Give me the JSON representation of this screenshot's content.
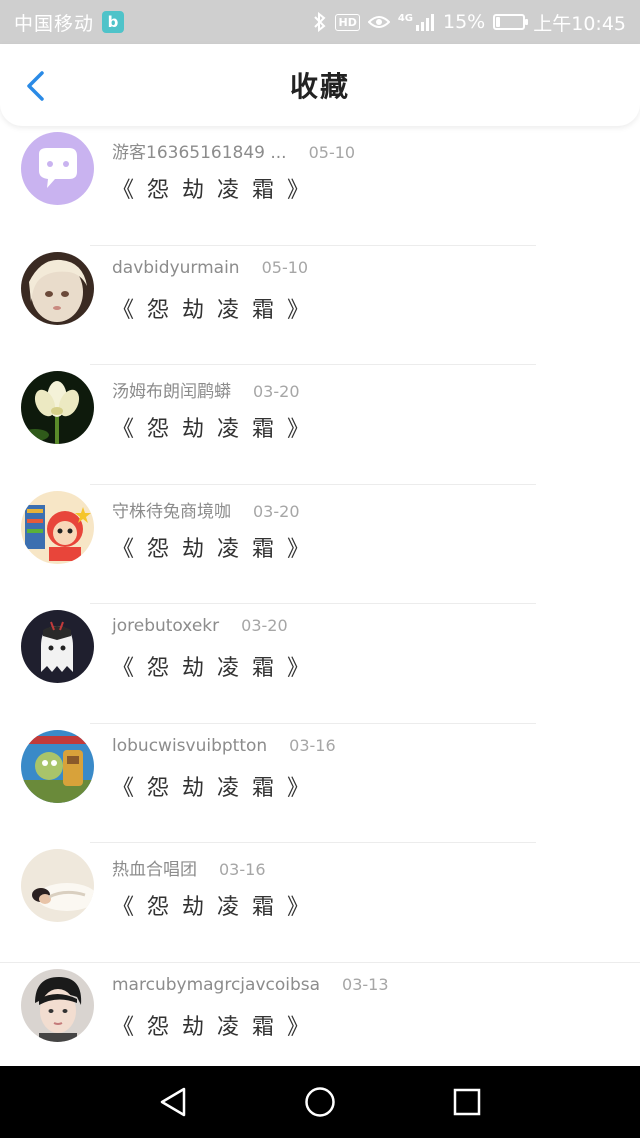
{
  "status_bar": {
    "carrier": "中国移动",
    "app_badge": "b",
    "hd": "HD",
    "network": "4G",
    "battery_text": "15%",
    "battery_level": 0.15,
    "time": "上午10:45"
  },
  "header": {
    "title": "收藏",
    "accent_color": "#2a8ae6"
  },
  "items": [
    {
      "username": "游客16365161849 ...",
      "date": "05-10",
      "title": "《 怨 劫 凌 霜 》",
      "avatar": "chat-bubble-avatar"
    },
    {
      "username": "davbidyurmain",
      "date": "05-10",
      "title": "《 怨 劫 凌 霜 》",
      "avatar": "doll-avatar"
    },
    {
      "username": "汤姆布朗闰鹛蟒",
      "date": "03-20",
      "title": "《 怨 劫 凌 霜 》",
      "avatar": "lotus-avatar"
    },
    {
      "username": "守株待兔商境咖",
      "date": "03-20",
      "title": "《 怨 劫 凌 霜 》",
      "avatar": "cartoon-avatar"
    },
    {
      "username": "jorebutoxekr",
      "date": "03-20",
      "title": "《 怨 劫 凌 霜 》",
      "avatar": "ghost-avatar"
    },
    {
      "username": "lobucwisvuibptton",
      "date": "03-16",
      "title": "《 怨 劫 凌 霜 》",
      "avatar": "game-avatar"
    },
    {
      "username": "热血合唱团",
      "date": "03-16",
      "title": "《 怨 劫 凌 霜 》",
      "avatar": "sleeping-avatar"
    },
    {
      "username": "marcubymagrcjavcoibsa",
      "date": "03-13",
      "title": "《 怨 劫 凌 霜 》",
      "avatar": "person-avatar"
    }
  ]
}
